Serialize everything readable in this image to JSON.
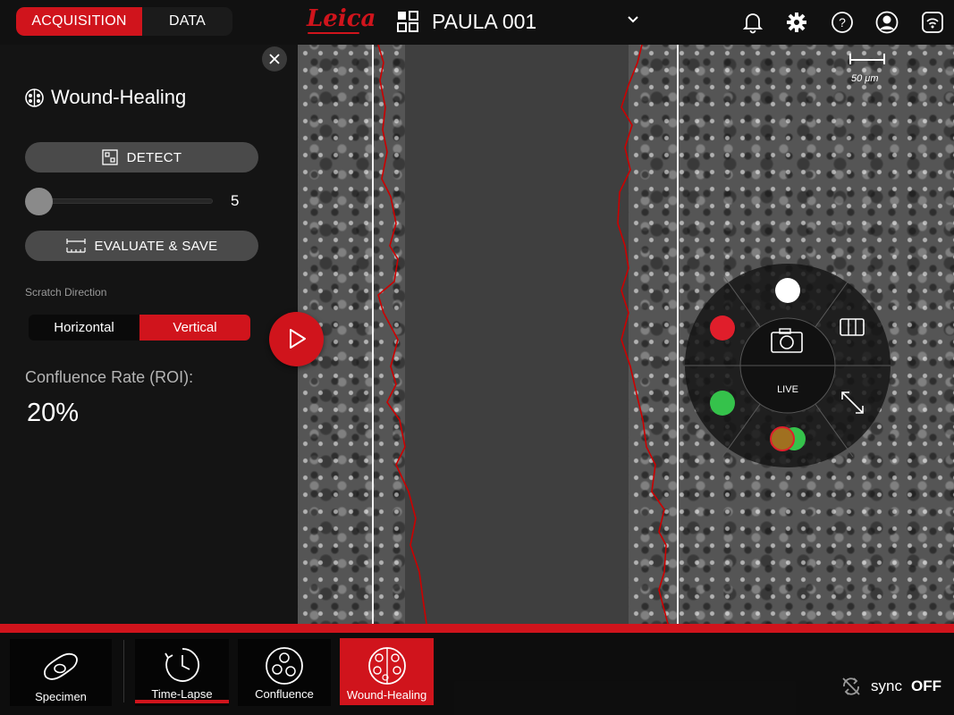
{
  "topbar": {
    "tabs": [
      {
        "label": "ACQUISITION",
        "active": true
      },
      {
        "label": "DATA",
        "active": false
      }
    ],
    "logo": "Leica",
    "project_title": "PAULA 001",
    "icons": [
      "bell-icon",
      "gear-icon",
      "help-icon",
      "account-icon",
      "wifi-icon"
    ]
  },
  "panel": {
    "tool_title": "Wound-Healing",
    "detect_label": "DETECT",
    "slider_value": "5",
    "evaluate_label": "EVALUATE & SAVE",
    "scratch_label": "Scratch Direction",
    "directions": [
      {
        "label": "Horizontal",
        "active": false
      },
      {
        "label": "Vertical",
        "active": true
      }
    ],
    "confluence_label": "Confluence Rate (ROI):",
    "confluence_value": "20%"
  },
  "view": {
    "scale_label": "50 μm",
    "live_label": "LIVE",
    "channels": [
      {
        "name": "brightfield",
        "color": "#ffffff"
      },
      {
        "name": "red",
        "color": "#e01e2b"
      },
      {
        "name": "green",
        "color": "#35c24b"
      }
    ]
  },
  "apps": [
    {
      "label": "Specimen",
      "active": false
    },
    {
      "label": "Time-Lapse",
      "active": false
    },
    {
      "label": "Confluence",
      "active": false
    },
    {
      "label": "Wound-Healing",
      "active": true
    }
  ],
  "sync": {
    "label": "sync",
    "state": "OFF"
  },
  "colors": {
    "accent": "#d0141c",
    "panel": "#141414"
  }
}
